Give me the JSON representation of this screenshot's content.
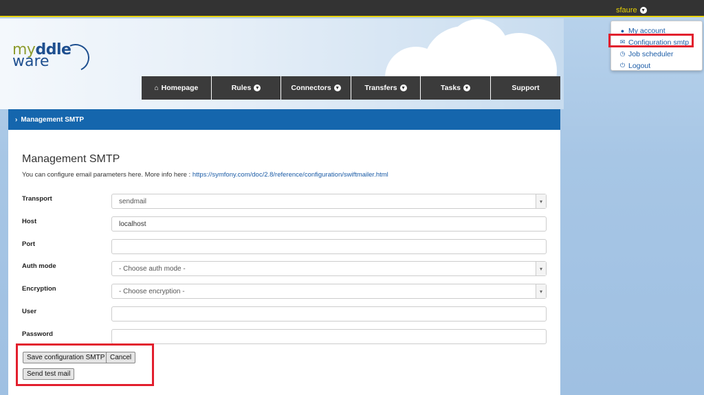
{
  "topbar": {
    "username": "sfaure"
  },
  "user_menu": {
    "items": [
      {
        "label": "My account",
        "icon": "user-icon"
      },
      {
        "label": "Configuration smtp",
        "icon": "envelope-icon"
      },
      {
        "label": "Job scheduler",
        "icon": "clock-icon"
      },
      {
        "label": "Logout",
        "icon": "power-icon"
      }
    ]
  },
  "logo": {
    "part1": "my",
    "part2": "ddle",
    "part3": "ware"
  },
  "nav": {
    "items": [
      {
        "label": "Homepage",
        "icon": "home-icon",
        "dropdown": false
      },
      {
        "label": "Rules",
        "dropdown": true
      },
      {
        "label": "Connectors",
        "dropdown": true
      },
      {
        "label": "Transfers",
        "dropdown": true
      },
      {
        "label": "Tasks",
        "dropdown": true
      },
      {
        "label": "Support",
        "dropdown": false
      }
    ]
  },
  "breadcrumb": {
    "label": "Management SMTP"
  },
  "page": {
    "title": "Management SMTP",
    "intro_text": "You can configure email parameters here. More info here : ",
    "intro_link": "https://symfony.com/doc/2.8/reference/configuration/swiftmailer.html"
  },
  "form": {
    "transport": {
      "label": "Transport",
      "value": "sendmail"
    },
    "host": {
      "label": "Host",
      "value": "localhost"
    },
    "port": {
      "label": "Port",
      "value": ""
    },
    "auth_mode": {
      "label": "Auth mode",
      "value": "- Choose auth mode -"
    },
    "encryption": {
      "label": "Encryption",
      "value": "- Choose encryption -"
    },
    "user": {
      "label": "User",
      "value": ""
    },
    "password": {
      "label": "Password",
      "value": ""
    }
  },
  "buttons": {
    "save": "Save configuration SMTP",
    "cancel": "Cancel",
    "test": "Send test mail"
  },
  "colors": {
    "accent": "#1566ad",
    "highlight": "#e21e2d",
    "topbar_user": "#e8d200",
    "nav_bg": "#3b3b3b"
  }
}
